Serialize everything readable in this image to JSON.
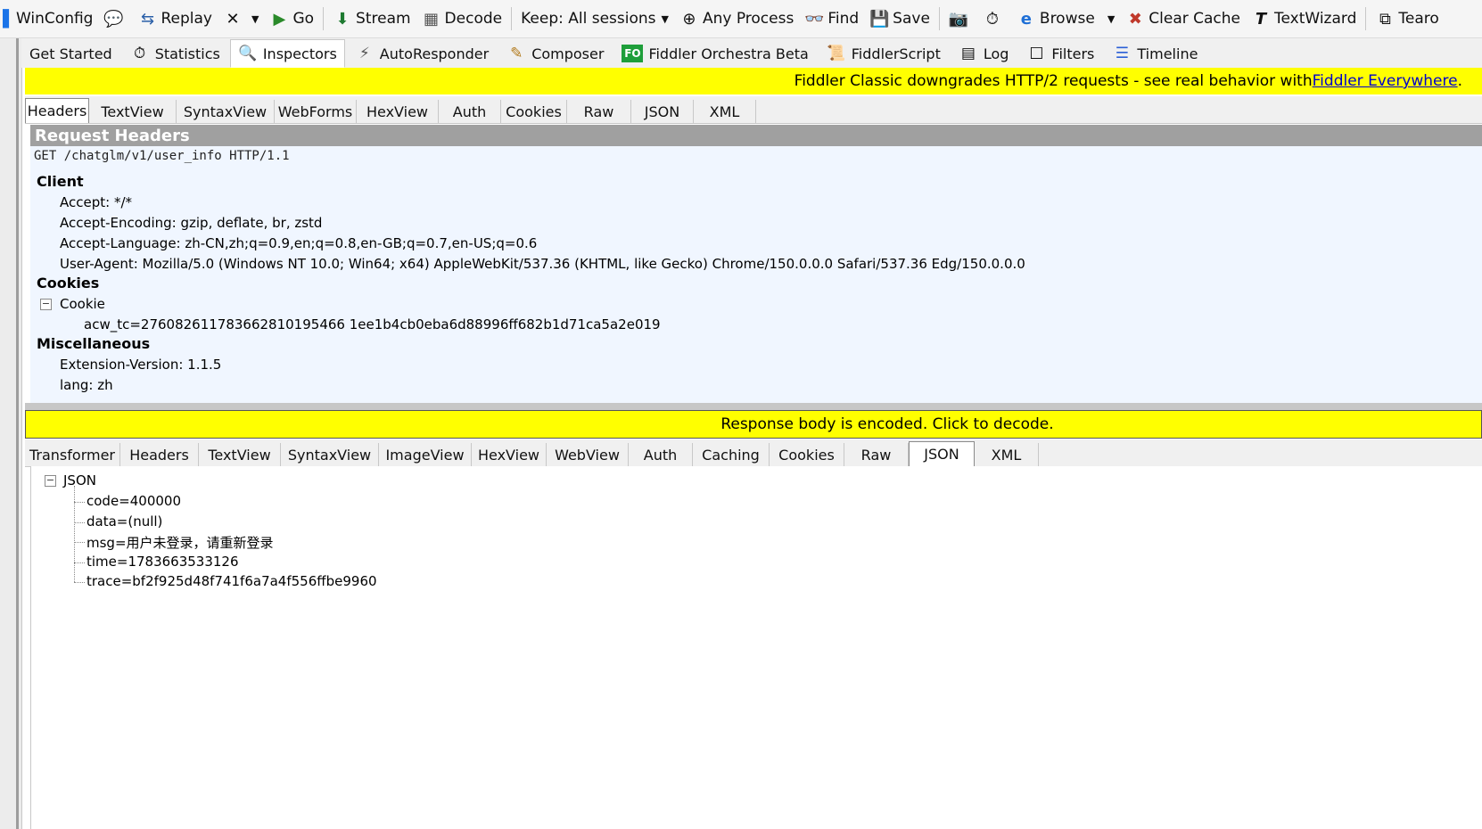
{
  "toolbar": {
    "winconfig": "WinConfig",
    "replay": "Replay",
    "go": "Go",
    "stream": "Stream",
    "decode": "Decode",
    "keep": "Keep: All sessions",
    "any_process": "Any Process",
    "find": "Find",
    "save": "Save",
    "browse": "Browse",
    "clear_cache": "Clear Cache",
    "textwizard": "TextWizard",
    "tearoff": "Tearo"
  },
  "tabs": {
    "get_started": "Get Started",
    "statistics": "Statistics",
    "inspectors": "Inspectors",
    "autoresponder": "AutoResponder",
    "composer": "Composer",
    "fo_badge": "FO",
    "orchestra": "Fiddler Orchestra Beta",
    "fiddlerscript": "FiddlerScript",
    "log": "Log",
    "filters": "Filters",
    "timeline": "Timeline"
  },
  "banner_top": {
    "text": "Fiddler Classic downgrades HTTP/2 requests - see real behavior with ",
    "link": "Fiddler Everywhere",
    "end": "."
  },
  "request_tabs": [
    "Headers",
    "TextView",
    "SyntaxView",
    "WebForms",
    "HexView",
    "Auth",
    "Cookies",
    "Raw",
    "JSON",
    "XML"
  ],
  "request": {
    "section_title": "Request Headers",
    "request_line": "GET /chatglm/v1/user_info HTTP/1.1",
    "client_group": "Client",
    "accept": "Accept: */*",
    "accept_encoding": "Accept-Encoding: gzip, deflate, br, zstd",
    "accept_language": "Accept-Language: zh-CN,zh;q=0.9,en;q=0.8,en-GB;q=0.7,en-US;q=0.6",
    "user_agent": "User-Agent: Mozilla/5.0 (Windows NT 10.0; Win64; x64) AppleWebKit/537.36 (KHTML, like Gecko) Chrome/150.0.0.0 Safari/537.36 Edg/150.0.0.0",
    "cookies_group": "Cookies",
    "cookie_label": "Cookie",
    "cookie_value": "acw_tc=276082611783662810195466 1ee1b4cb0eba6d88996ff682b1d71ca5a2e019",
    "misc_group": "Miscellaneous",
    "extension_version": "Extension-Version: 1.1.5",
    "lang": "lang: zh"
  },
  "banner_bottom": "Response body is encoded. Click to decode.",
  "response_tabs": [
    "Transformer",
    "Headers",
    "TextView",
    "SyntaxView",
    "ImageView",
    "HexView",
    "WebView",
    "Auth",
    "Caching",
    "Cookies",
    "Raw",
    "JSON",
    "XML"
  ],
  "response": {
    "root": "JSON",
    "items": [
      "code=400000",
      "data=(null)",
      "msg=用户未登录，请重新登录",
      "time=1783663533126",
      "trace=bf2f925d48f741f6a7a4f556ffbe9960"
    ]
  }
}
